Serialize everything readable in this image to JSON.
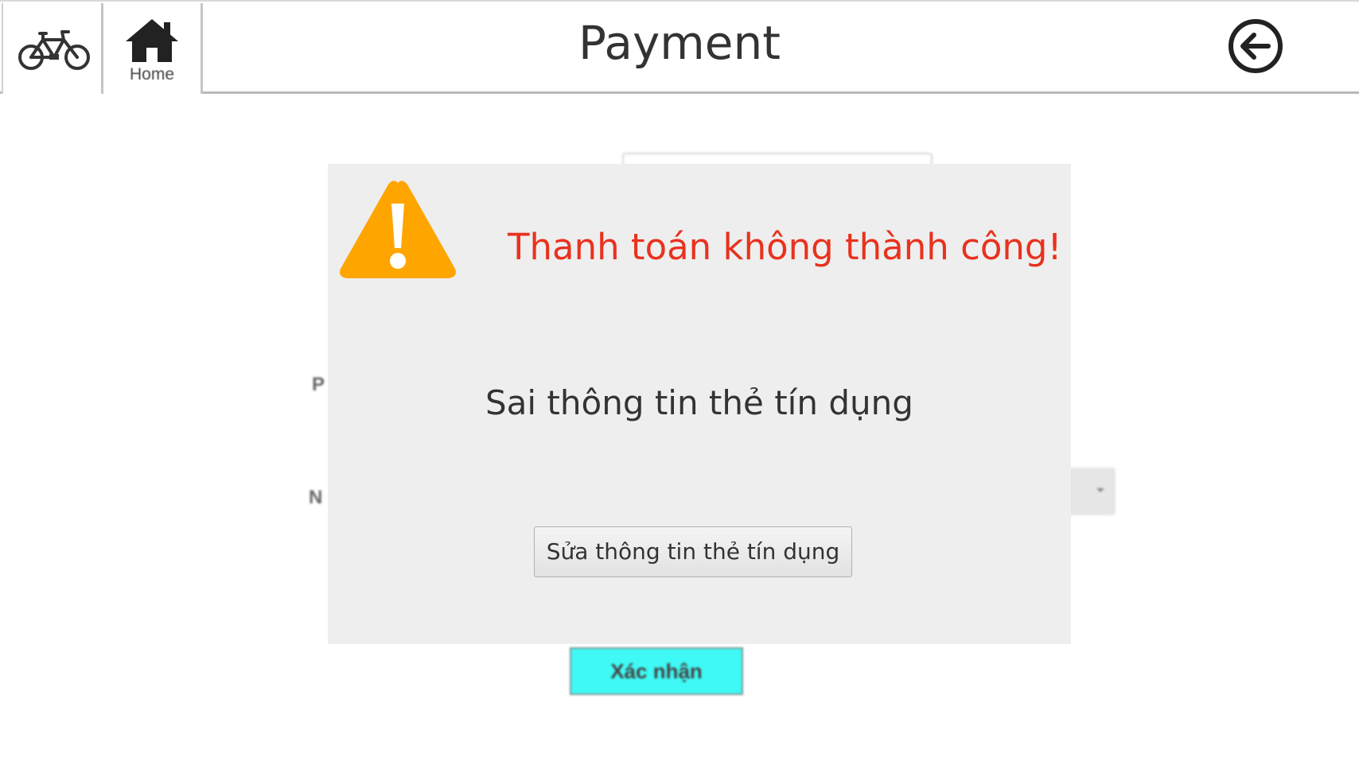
{
  "header": {
    "title": "Payment",
    "home_label": "Home",
    "logo_icon": "bicycle-icon",
    "home_icon": "home-icon",
    "back_icon": "back-arrow-icon"
  },
  "background_form": {
    "label_1_partial": "P",
    "label_2_partial": "N",
    "confirm_label": "Xác nhận",
    "confirm_color": "#3ef9f5"
  },
  "dialog": {
    "icon": "warning-icon",
    "icon_color": "#ffa500",
    "title": "Thanh toán không thành công!",
    "title_color": "#e8321e",
    "message": "Sai thông tin thẻ tín dụng",
    "button_label": "Sửa thông tin thẻ tín dụng"
  }
}
